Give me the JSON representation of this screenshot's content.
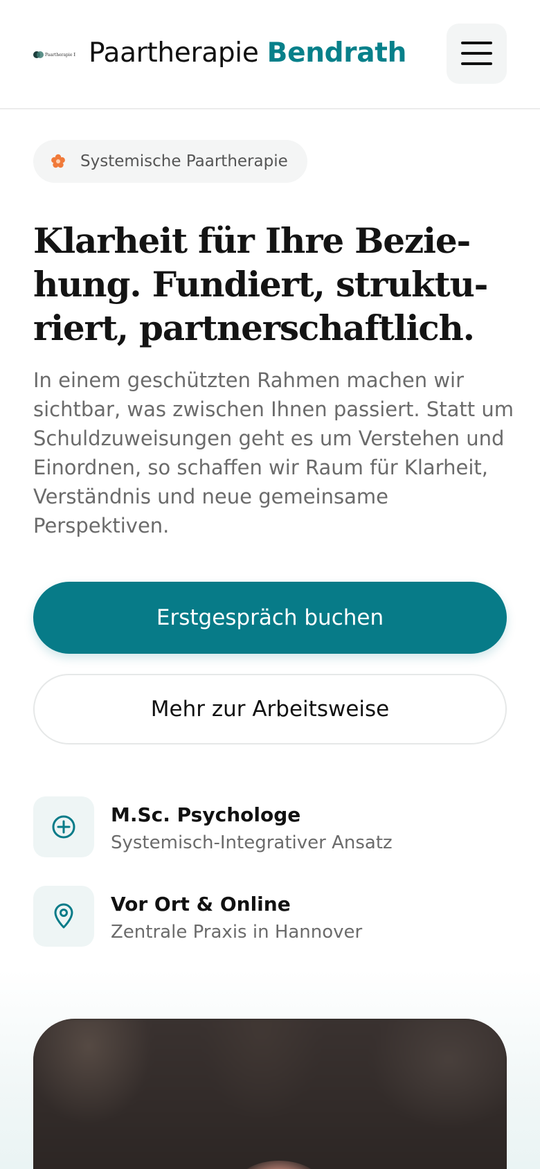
{
  "header": {
    "logo_text": "Paartherapie Bendrath",
    "brand_plain": "Paartherapie",
    "brand_accent": "Bendrath",
    "menu_icon": "hamburger-menu-icon"
  },
  "hero": {
    "badge_icon": "flower-icon",
    "badge_label": "Systemische Paartherapie",
    "headline_lines": [
      "Klarheit für Ihre Bezie-",
      "hung. Fundiert, struktu-",
      "riert, partnerschaftlich."
    ],
    "lead_lines": [
      "In einem geschützten Rahmen machen wir",
      "sichtbar, was zwischen Ihnen passiert. Statt um",
      "Schuldzuweisungen geht es um Verstehen und",
      "Einordnen, so schaffen wir Raum für Klarheit,",
      "Verständnis und neue gemeinsame",
      "Perspektiven."
    ],
    "primary_cta": "Erstgespräch buchen",
    "secondary_cta": "Mehr zur Arbeitsweise"
  },
  "features": [
    {
      "icon": "plus-circle-icon",
      "title": "M.Sc. Psychologe",
      "subtitle": "Systemisch-Integrativer Ansatz"
    },
    {
      "icon": "map-pin-icon",
      "title": "Vor Ort & Online",
      "subtitle": "Zentrale Praxis in Hannover"
    }
  ],
  "colors": {
    "accent": "#077b88",
    "badge_flower": "#f07a3a",
    "text_primary": "#111111",
    "text_muted": "#6b6b6b"
  }
}
